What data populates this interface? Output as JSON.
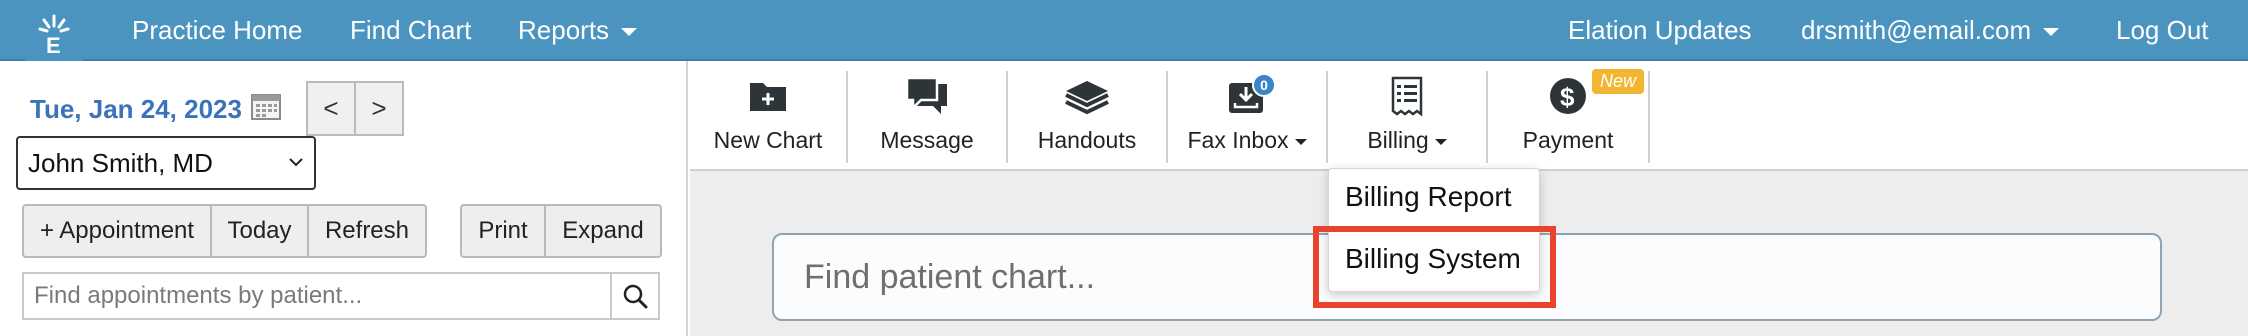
{
  "topnav": {
    "logo_icon": "elation-logo-icon",
    "practice_home": "Practice Home",
    "find_chart": "Find Chart",
    "reports": "Reports",
    "updates": "Elation Updates",
    "user_email": "drsmith@email.com",
    "logout": "Log Out",
    "bg_color": "#4a94bf"
  },
  "schedule": {
    "date": "Tue, Jan 24, 2023",
    "prev_label": "<",
    "next_label": ">",
    "provider": "John Smith, MD",
    "buttons": [
      "+ Appointment",
      "Today",
      "Refresh"
    ],
    "buttons2": [
      "Print",
      "Expand"
    ],
    "search_placeholder": "Find appointments by patient..."
  },
  "toolbar": {
    "items": [
      {
        "label": "New Chart",
        "icon": "new-chart-folder-icon"
      },
      {
        "label": "Message",
        "icon": "message-icon"
      },
      {
        "label": "Handouts",
        "icon": "handouts-book-icon"
      },
      {
        "label": "Fax Inbox",
        "icon": "fax-inbox-icon",
        "badge": "0"
      },
      {
        "label": "Billing",
        "icon": "billing-icon"
      },
      {
        "label": "Payment",
        "icon": "payment-dollar-icon",
        "tag": "New"
      }
    ]
  },
  "billing_menu": {
    "items": [
      "Billing Report",
      "Billing System"
    ],
    "highlighted": "Billing System",
    "highlight_color": "#e8432d"
  },
  "main": {
    "find_chart_placeholder": "Find patient chart..."
  }
}
